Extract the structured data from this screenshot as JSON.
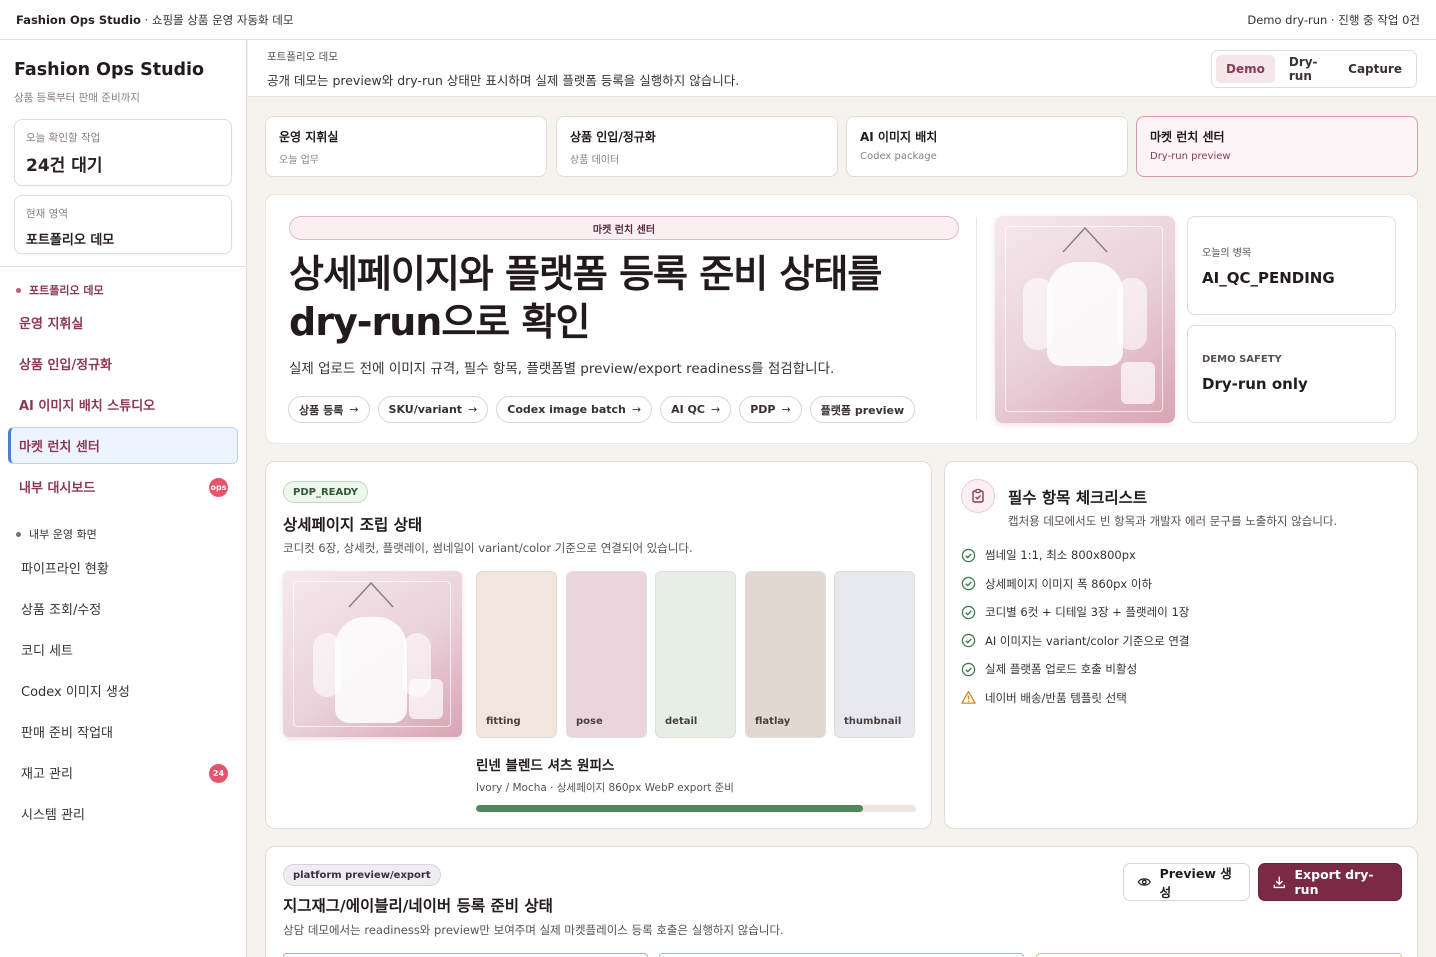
{
  "topbar": {
    "brand": "Fashion Ops Studio",
    "subtitle": " · 쇼핑몰 상품 운영 자동화 데모",
    "status": "Demo dry-run · 진행 중 작업 0건"
  },
  "sidebar": {
    "title": "Fashion Ops Studio",
    "subtitle": "상품 등록부터 판매 준비까지",
    "today": {
      "label": "오늘 확인할 작업",
      "value": "24건 대기"
    },
    "area": {
      "label": "현재 영역",
      "value": "포트폴리오 데모"
    },
    "section_demo": "포트폴리오 데모",
    "demo_items": [
      {
        "label": "운영 지휘실"
      },
      {
        "label": "상품 인입/정규화"
      },
      {
        "label": "AI 이미지 배치 스튜디오"
      },
      {
        "label": "마켓 런치 센터"
      },
      {
        "label": "내부 대시보드",
        "badge": "ops"
      }
    ],
    "section_internal": "내부 운영 화면",
    "internal_items": [
      {
        "label": "파이프라인 현황"
      },
      {
        "label": "상품 조회/수정"
      },
      {
        "label": "코디 세트"
      },
      {
        "label": "Codex 이미지 생성"
      },
      {
        "label": "판매 준비 작업대"
      },
      {
        "label": "재고 관리",
        "badge": "24"
      },
      {
        "label": "시스템 관리"
      }
    ]
  },
  "header": {
    "small": "포트폴리오 데모",
    "text": "공개 데모는 preview와 dry-run 상태만 표시하며 실제 플랫폼 등록을 실행하지 않습니다.",
    "modes": [
      "Demo",
      "Dry-run",
      "Capture"
    ]
  },
  "nav_cards": [
    {
      "title": "운영 지휘실",
      "sub": "오늘 업무"
    },
    {
      "title": "상품 인입/정규화",
      "sub": "상품 데이터"
    },
    {
      "title": "AI 이미지 배치",
      "sub": "Codex package"
    },
    {
      "title": "마켓 런치 센터",
      "sub": "Dry-run preview"
    }
  ],
  "hero": {
    "pill": "마켓 런치 센터",
    "title_line1": "상세페이지와 플랫폼 등록 준비 상태를",
    "title_line2": "dry-run으로 확인",
    "desc": "실제 업로드 전에 이미지 규격, 필수 항목, 플랫폼별 preview/export readiness를 점검합니다.",
    "chips": [
      {
        "label": "상품 등록",
        "arrow": "→"
      },
      {
        "label": "SKU/variant",
        "arrow": "→"
      },
      {
        "label": "Codex image batch",
        "arrow": "→"
      },
      {
        "label": "AI QC",
        "arrow": "→"
      },
      {
        "label": "PDP",
        "arrow": "→"
      },
      {
        "label": "플랫폼 preview",
        "arrow": ""
      }
    ],
    "stat1": {
      "label": "오늘의 병목",
      "value": "AI_QC_PENDING"
    },
    "stat2": {
      "label": "DEMO SAFETY",
      "value": "Dry-run only"
    }
  },
  "pdp": {
    "tag": "PDP_READY",
    "title": "상세페이지 조립 상태",
    "desc": "코디컷 6장, 상세컷, 플랫레이, 썸네일이 variant/color 기준으로 연결되어 있습니다.",
    "swatches": [
      {
        "label": "fitting",
        "color": "#f2e5de"
      },
      {
        "label": "pose",
        "color": "#ead5dd"
      },
      {
        "label": "detail",
        "color": "#e7eee6"
      },
      {
        "label": "flatlay",
        "color": "#e3d8d1"
      },
      {
        "label": "thumbnail",
        "color": "#e7e9ee"
      }
    ],
    "product_name": "린넨 블렌드 셔츠 원피스",
    "product_meta": "Ivory / Mocha · 상세페이지 860px WebP export 준비",
    "progress": 0.88
  },
  "checklist": {
    "title": "필수 항목 체크리스트",
    "sub": "캡처용 데모에서도 빈 항목과 개발자 에러 문구를 노출하지 않습니다.",
    "items": [
      {
        "text": "썸네일 1:1, 최소 800x800px",
        "status": "ok"
      },
      {
        "text": "상세페이지 이미지 폭 860px 이하",
        "status": "ok"
      },
      {
        "text": "코디별 6컷 + 디테일 3장 + 플랫레이 1장",
        "status": "ok"
      },
      {
        "text": "AI 이미지는 variant/color 기준으로 연결",
        "status": "ok"
      },
      {
        "text": "실제 플랫폼 업로드 호출 비활성",
        "status": "ok"
      },
      {
        "text": "네이버 배송/반품 템플릿 선택",
        "status": "warn"
      }
    ]
  },
  "platform": {
    "tag": "platform preview/export",
    "title": "지그재그/에이블리/네이버 등록 준비 상태",
    "desc": "상담 데모에서는 readiness와 preview만 보여주며 실제 마켓플레이스 등록 호출은 실행하지 않습니다.",
    "preview_button": "Preview 생성",
    "export_button": "Export dry-run"
  }
}
